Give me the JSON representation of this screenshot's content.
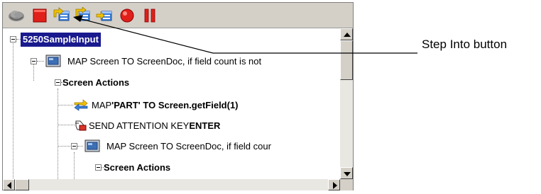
{
  "toolbar": {
    "buttons": [
      {
        "name": "Connect",
        "icon": "cloud-icon"
      },
      {
        "name": "Stop",
        "icon": "stop-icon"
      },
      {
        "name": "Step Into",
        "icon": "step-into-icon"
      },
      {
        "name": "Step Over",
        "icon": "step-over-icon"
      },
      {
        "name": "Step Out",
        "icon": "step-out-icon"
      },
      {
        "name": "Record",
        "icon": "record-icon"
      },
      {
        "name": "Pause",
        "icon": "pause-icon"
      }
    ]
  },
  "tree": {
    "root_label": "5250SampleInput",
    "item1_label": "MAP Screen TO ScreenDoc, if field count is not",
    "item2_label": "Screen Actions",
    "item3_prefix": "MAP ",
    "item3_bold": "'PART' TO Screen.getField(1)",
    "item4_prefix": "SEND ATTENTION KEY ",
    "item4_bold": "ENTER",
    "item5_label": "MAP Screen TO ScreenDoc, if field cour",
    "item6_label": "Screen Actions"
  },
  "callout": {
    "label": "Step Into button"
  },
  "colors": {
    "selection": "#1a1a8f",
    "toolbar_bg": "#d4d0c8",
    "stop_red": "#e0201a"
  }
}
